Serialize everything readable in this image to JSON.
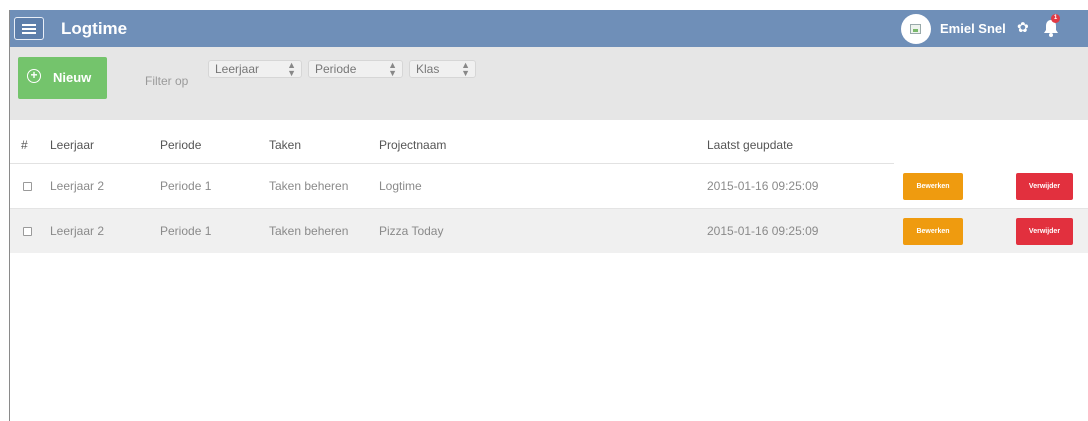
{
  "header": {
    "app_title": "Logtime",
    "user_name": "Emiel Snel",
    "notification_count": "1",
    "icons": [
      "menu-icon",
      "avatar-broken-image-icon",
      "gear-icon",
      "bell-icon"
    ],
    "colors": {
      "bar": "#6f8fb8"
    }
  },
  "toolbar": {
    "new_label": "Nieuw",
    "filter_label": "Filter op",
    "filters": [
      {
        "selected": "Leerjaar"
      },
      {
        "selected": "Periode"
      },
      {
        "selected": "Klas"
      }
    ],
    "colors": {
      "new_button": "#74c46c"
    }
  },
  "table": {
    "columns": [
      "#",
      "Leerjaar",
      "Periode",
      "Taken",
      "Projectnaam",
      "Laatst geupdate"
    ],
    "rows": [
      {
        "leerjaar": "Leerjaar 2",
        "periode": "Periode 1",
        "taken": "Taken beheren",
        "projectnaam": "Logtime",
        "updated": "2015-01-16 09:25:09",
        "edit_label": "Bewerken",
        "delete_label": "Verwijder"
      },
      {
        "leerjaar": "Leerjaar 2",
        "periode": "Periode 1",
        "taken": "Taken beheren",
        "projectnaam": "Pizza Today",
        "updated": "2015-01-16 09:25:09",
        "edit_label": "Bewerken",
        "delete_label": "Verwijder"
      }
    ],
    "colors": {
      "edit": "#ef9b0f",
      "delete": "#e2303e"
    }
  }
}
